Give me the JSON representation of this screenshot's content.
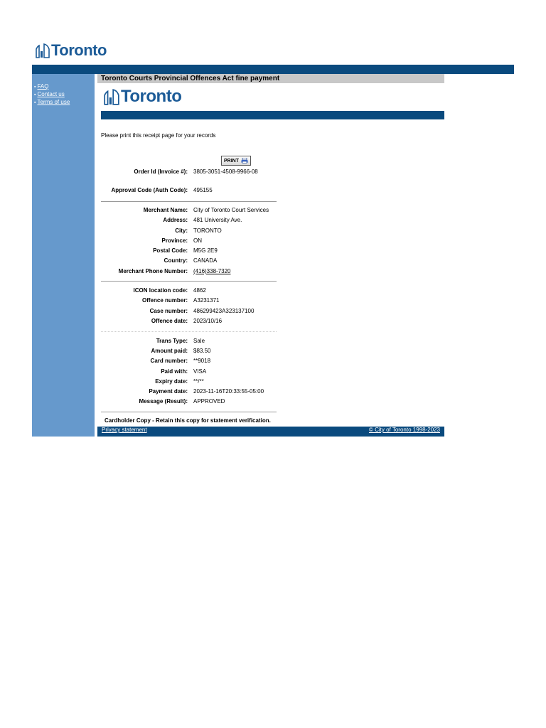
{
  "header": {
    "logo_text": "Toronto"
  },
  "sidebar": {
    "links": [
      "FAQ",
      "Contact us",
      "Terms of use"
    ]
  },
  "main": {
    "title": "Toronto Courts Provincial Offences Act fine payment",
    "inner_logo_text": "Toronto",
    "instruction": "Please print this receipt page for your records",
    "print_button": "PRINT"
  },
  "receipt": {
    "order": [
      {
        "label": "Order Id (Invoice #):",
        "value": "3805-3051-4508-9966-08"
      },
      {
        "label": "Approval Code (Auth Code):",
        "value": "495155"
      }
    ],
    "merchant": [
      {
        "label": "Merchant Name:",
        "value": "City of Toronto Court Services"
      },
      {
        "label": "Address:",
        "value": "481 University Ave."
      },
      {
        "label": "City:",
        "value": "TORONTO"
      },
      {
        "label": "Province:",
        "value": "ON"
      },
      {
        "label": "Postal Code:",
        "value": "M5G 2E9"
      },
      {
        "label": "Country:",
        "value": "CANADA"
      },
      {
        "label": "Merchant Phone Number:",
        "value": "(416)338-7320"
      }
    ],
    "offence": [
      {
        "label": "ICON location code:",
        "value": "4862"
      },
      {
        "label": "Offence number:",
        "value": "A3231371"
      },
      {
        "label": "Case number:",
        "value": "486299423A323137100"
      },
      {
        "label": "Offence date:",
        "value": "2023/10/16"
      }
    ],
    "transaction": [
      {
        "label": "Trans Type:",
        "value": "Sale"
      },
      {
        "label": "Amount paid:",
        "value": "$83.50"
      },
      {
        "label": "Card number:",
        "value": "**9018"
      },
      {
        "label": "Paid with:",
        "value": "VISA"
      },
      {
        "label": "Expiry date:",
        "value": "**/**"
      },
      {
        "label": "Payment date:",
        "value": "2023-11-16T20:33:55-05:00"
      },
      {
        "label": "Message (Result):",
        "value": "APPROVED"
      }
    ],
    "cardholder_note": "Cardholder Copy - Retain this copy for statement verification."
  },
  "footer": {
    "privacy": "Privacy statement",
    "copyright": "© City of Toronto 1998-2023"
  },
  "colors": {
    "dark_blue": "#0a4a7e",
    "sidebar_blue": "#6699cc",
    "title_gray": "#c8c8c8",
    "logo_blue": "#1c5b97"
  }
}
